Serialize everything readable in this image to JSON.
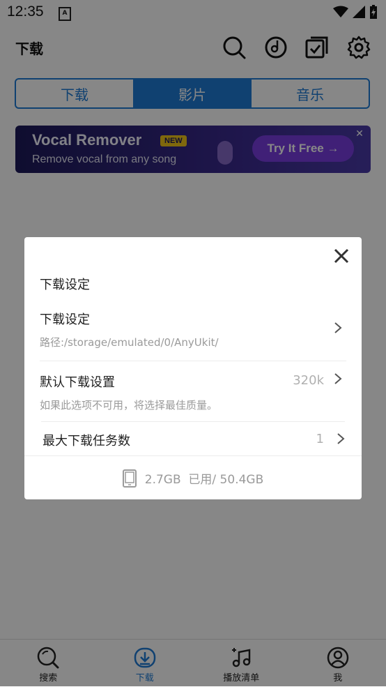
{
  "status_bar": {
    "time": "12:35",
    "notification_icon": "A"
  },
  "app_bar": {
    "title": "下载",
    "icons": [
      "search-icon",
      "music-disc-icon",
      "checklist-icon",
      "gear-icon"
    ]
  },
  "tabs": [
    {
      "label": "下载",
      "active": false
    },
    {
      "label": "影片",
      "active": true
    },
    {
      "label": "音乐",
      "active": false
    }
  ],
  "banner": {
    "title": "Vocal Remover",
    "badge": "NEW",
    "subtitle": "Remove vocal from any song",
    "button": "Try It Free →"
  },
  "dialog": {
    "title": "下载设定",
    "rows": [
      {
        "title": "下载设定",
        "subtitle": "路径:/storage/emulated/0/AnyUkit/",
        "value": ""
      },
      {
        "title": "默认下载设置",
        "subtitle": "如果此选项不可用，将选择最佳质量。",
        "value": "320k"
      },
      {
        "title": "最大下载任务数",
        "subtitle": "",
        "value": "1"
      }
    ],
    "storage": "2.7GB  已用/ 50.4GB"
  },
  "bottom_nav": [
    {
      "label": "搜索",
      "icon": "search-icon",
      "active": false
    },
    {
      "label": "下载",
      "icon": "download-icon",
      "active": true
    },
    {
      "label": "播放清单",
      "icon": "playlist-add-icon",
      "active": false
    },
    {
      "label": "我",
      "icon": "user-icon",
      "active": false
    }
  ],
  "colors": {
    "accent": "#1f7cd6",
    "overlay": "#00000078"
  }
}
